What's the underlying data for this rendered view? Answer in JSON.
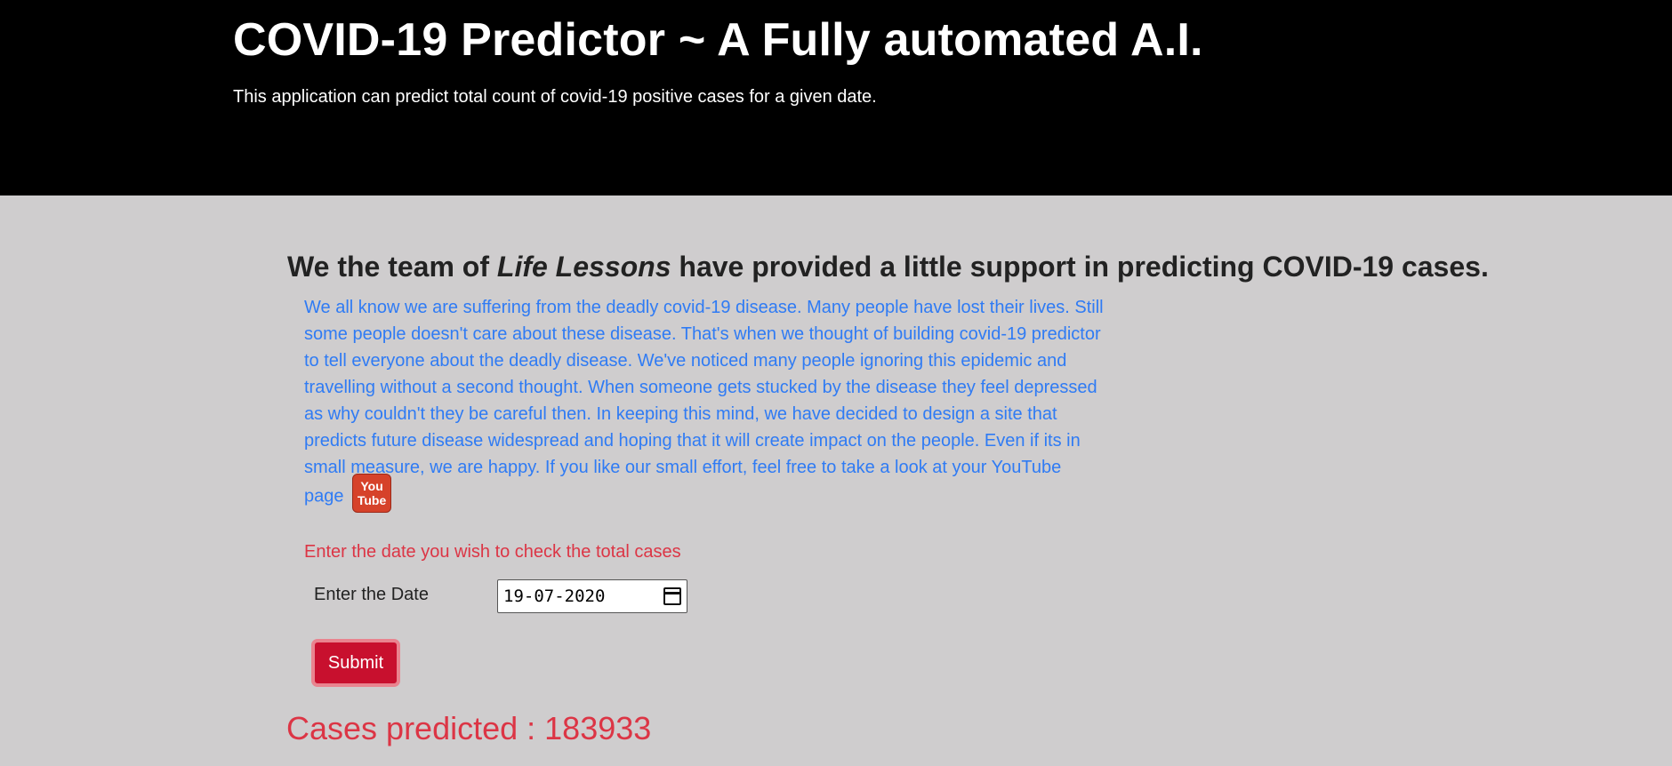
{
  "header": {
    "title": "COVID-19 Predictor ~ A Fully automated A.I.",
    "subtitle": "This application can predict total count of covid-19 positive cases for a given date."
  },
  "main": {
    "heading_prefix": "We the team of ",
    "heading_team": "Life Lessons",
    "heading_suffix": " have provided a little support in predicting COVID-19 cases.",
    "intro_text": "We all know we are suffering from the deadly covid-19 disease. Many people have lost their lives. Still some people doesn't care about these disease. That's when we thought of building covid-19 predictor to tell everyone about the deadly disease. We've noticed many people ignoring this epidemic and travelling without a second thought. When someone gets stucked by the disease they feel depressed as why couldn't they be careful then. In keeping this mind, we have decided to design a site that predicts future disease widespread and hoping that it will create impact on the people. Even if its in small measure, we are happy. If you like our small effort, feel free to take a look at your ",
    "youtube_link": "YouTube page",
    "youtube_icon_top": "You",
    "youtube_icon_bottom": "Tube",
    "prompt": "Enter the date you wish to check the total cases",
    "date_label": "Enter the Date",
    "date_value": "19-07-2020",
    "submit_label": "Submit",
    "result": "Cases predicted : 183933"
  },
  "colors": {
    "header_bg": "#000000",
    "page_bg": "#cfcdce",
    "intro_text": "#2f7bf4",
    "accent_red": "#dc3545",
    "button_bg": "#c8102e"
  }
}
